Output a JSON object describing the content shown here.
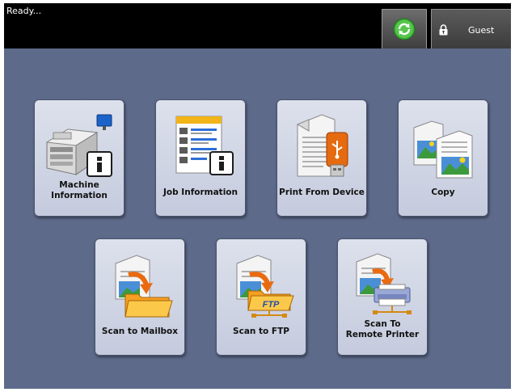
{
  "status": {
    "text": "Ready..."
  },
  "header": {
    "refresh_icon": "refresh-icon",
    "user": {
      "label": "Guest",
      "icon": "lock-user-icon"
    }
  },
  "tiles": [
    {
      "line1": "Machine",
      "line2": "Information",
      "icon": "machine-info-icon"
    },
    {
      "line1": "Job Information",
      "line2": "",
      "icon": "job-info-icon"
    },
    {
      "line1": "Print From Device",
      "line2": "",
      "icon": "usb-print-icon"
    },
    {
      "line1": "Copy",
      "line2": "",
      "icon": "copy-icon"
    },
    {
      "line1": "Scan to Mailbox",
      "line2": "",
      "icon": "scan-mailbox-icon"
    },
    {
      "line1": "Scan to FTP",
      "line2": "",
      "icon": "scan-ftp-icon",
      "badge": "FTP"
    },
    {
      "line1": "Scan To",
      "line2": "Remote Printer",
      "icon": "scan-remote-printer-icon"
    }
  ],
  "colors": {
    "background": "#5d6a8a",
    "topbar": "#000000",
    "refresh_green": "#3cae3a",
    "folder_orange": "#f5a020",
    "usb_orange": "#e66a10",
    "info_badge": "#1d1d1d"
  }
}
